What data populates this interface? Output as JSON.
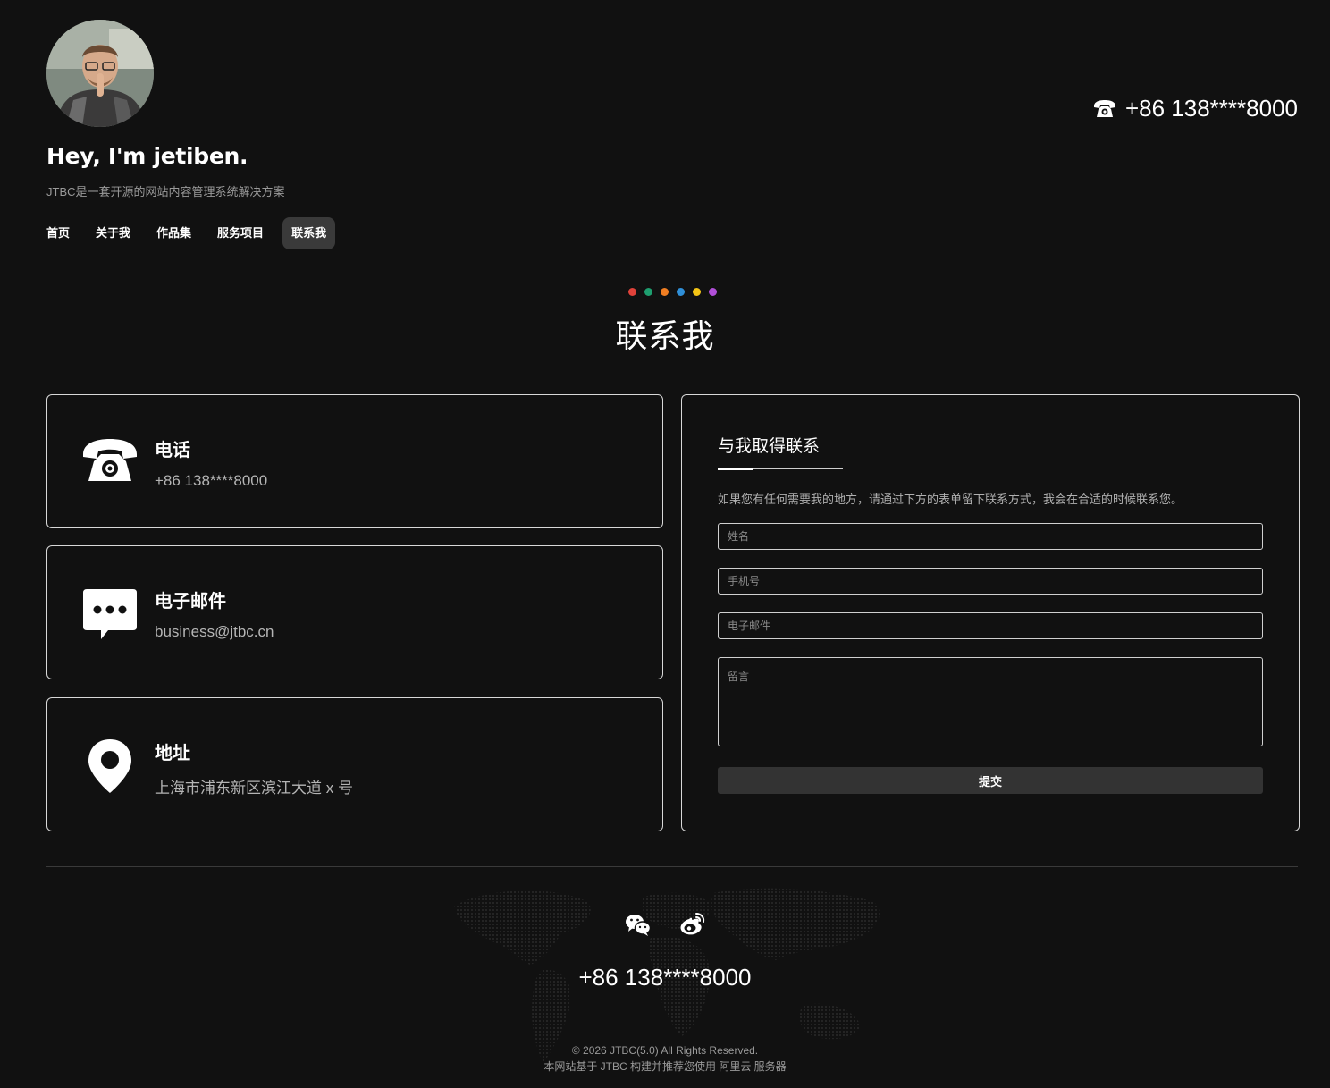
{
  "header": {
    "title": "Hey, I'm jetiben.",
    "subtitle": "JTBC是一套开源的网站内容管理系统解决方案",
    "phone": "+86 138****8000"
  },
  "nav": {
    "items": [
      {
        "label": "首页"
      },
      {
        "label": "关于我"
      },
      {
        "label": "作品集"
      },
      {
        "label": "服务项目"
      },
      {
        "label": "联系我",
        "active": true
      }
    ]
  },
  "section": {
    "title": "联系我",
    "dot_colors": [
      "#e0423a",
      "#1e9e6f",
      "#f07e22",
      "#2f8fd8",
      "#f3c415",
      "#b14fd8"
    ]
  },
  "contact_cards": {
    "phone": {
      "title": "电话",
      "value": "+86 138****8000",
      "icon": "telephone-icon"
    },
    "email": {
      "title": "电子邮件",
      "value": "business@jtbc.cn",
      "icon": "chat-bubble-icon"
    },
    "address": {
      "title": "地址",
      "value": "上海市浦东新区滨江大道 x 号",
      "icon": "map-pin-icon"
    }
  },
  "form": {
    "title": "与我取得联系",
    "description": "如果您有任何需要我的地方，请通过下方的表单留下联系方式，我会在合适的时候联系您。",
    "name_placeholder": "姓名",
    "mobile_placeholder": "手机号",
    "email_placeholder": "电子邮件",
    "message_placeholder": "留言",
    "submit_label": "提交"
  },
  "footer": {
    "phone": "+86 138****8000",
    "social": [
      "wechat-icon",
      "weibo-icon"
    ],
    "copyright": "© 2026 JTBC(5.0) All Rights Reserved.",
    "powered": "本网站基于 JTBC 构建并推荐您使用 阿里云 服务器"
  }
}
